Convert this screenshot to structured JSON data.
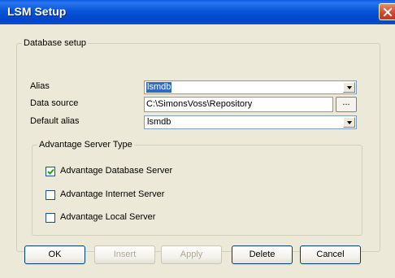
{
  "window": {
    "title": "LSM Setup"
  },
  "database_setup": {
    "legend": "Database setup",
    "alias": {
      "label": "Alias",
      "value": "lsmdb"
    },
    "data_source": {
      "label": "Data source",
      "value": "C:\\SimonsVoss\\Repository",
      "browse_label": "..."
    },
    "default_alias": {
      "label": "Default alias",
      "value": "lsmdb"
    }
  },
  "advantage_server_type": {
    "legend": "Advantage Server Type",
    "options": [
      {
        "label": "Advantage Database Server",
        "checked": true
      },
      {
        "label": "Advantage Internet Server",
        "checked": false
      },
      {
        "label": "Advantage Local Server",
        "checked": false
      }
    ]
  },
  "buttons": {
    "ok": "OK",
    "insert": "Insert",
    "apply": "Apply",
    "delete": "Delete",
    "cancel": "Cancel"
  }
}
